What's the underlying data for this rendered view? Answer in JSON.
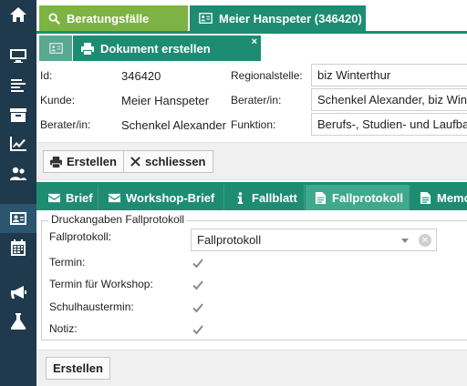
{
  "top_tabs": [
    {
      "label": "Beratungsfälle",
      "icon": "search-icon",
      "color": "#7cb342"
    },
    {
      "label": "Meier Hanspeter (346420)",
      "icon": "id-card-icon",
      "color": "#1e8c72"
    }
  ],
  "sub_tabs": {
    "active_label": "Dokument erstellen",
    "close": "×"
  },
  "info": {
    "id_label": "Id:",
    "id_value": "346420",
    "kunde_label": "Kunde:",
    "kunde_value": "Meier Hanspeter",
    "berater_label": "Berater/in:",
    "berater_value": "Schenkel Alexander",
    "regionalstelle_label": "Regionalstelle:",
    "regionalstelle_value": "biz Winterthur",
    "berater2_label": "Berater/in:",
    "berater2_value": "Schenkel Alexander, biz Winterthur",
    "funktion_label": "Funktion:",
    "funktion_value": "Berufs-, Studien- und Laufbahnberatung"
  },
  "actions": {
    "erstellen": "Erstellen",
    "schliessen": "schliessen"
  },
  "doc_tabs": [
    {
      "label": "Brief",
      "icon": "envelope-icon",
      "active": false
    },
    {
      "label": "Workshop-Brief",
      "icon": "envelope-icon",
      "active": false
    },
    {
      "label": "Fallblatt",
      "icon": "info-icon",
      "active": false
    },
    {
      "label": "Fallprotokoll",
      "icon": "document-icon",
      "active": true
    },
    {
      "label": "Memo",
      "icon": "document-icon",
      "active": false
    }
  ],
  "form": {
    "legend": "Druckangaben Fallprotokoll",
    "fallprotokoll_label": "Fallprotokoll:",
    "fallprotokoll_value": "Fallprotokoll",
    "fields": [
      {
        "label": "Termin:",
        "checked": true
      },
      {
        "label": "Termin für Workshop:",
        "checked": true
      },
      {
        "label": "Schulhaustermin:",
        "checked": true
      },
      {
        "label": "Notiz:",
        "checked": true
      }
    ],
    "submit": "Erstellen"
  },
  "colors": {
    "sidebar": "#1f3a4d",
    "green": "#7cb342",
    "teal": "#1e8c72",
    "teal_active": "#3fa98c"
  }
}
